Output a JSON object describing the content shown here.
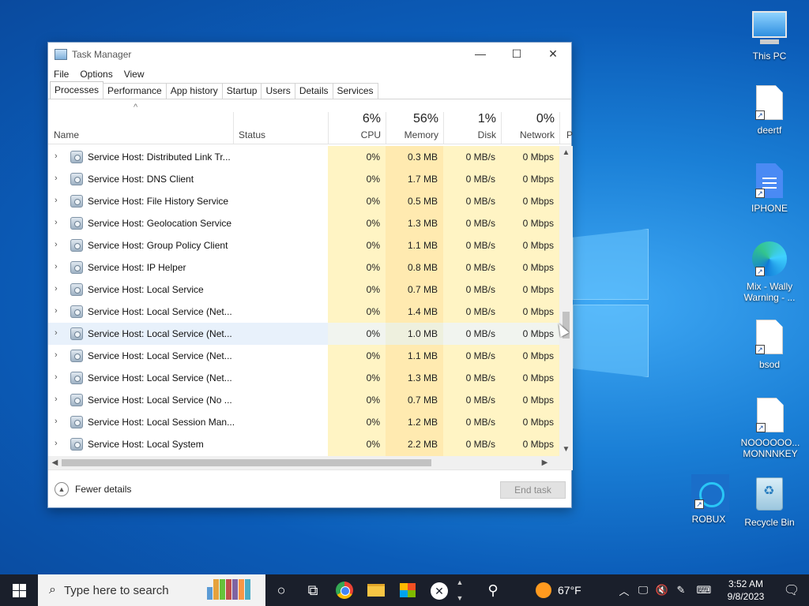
{
  "desktop": {
    "icons": [
      {
        "label": "This PC",
        "icon": "computer-icon"
      },
      {
        "label": "deertf",
        "icon": "text-document-icon"
      },
      {
        "label": "IPHONE",
        "icon": "google-docs-icon"
      },
      {
        "label": "Mix - Wally Warning - ...",
        "icon": "edge-icon"
      },
      {
        "label": "bsod",
        "icon": "text-document-icon"
      },
      {
        "label": "NOOOOOO... MONNNKEY",
        "icon": "text-document-icon"
      },
      {
        "label": "ROBUX",
        "icon": "cortana-icon"
      },
      {
        "label": "Recycle Bin",
        "icon": "recycle-bin-icon"
      }
    ]
  },
  "taskmanager": {
    "title": "Task Manager",
    "controls": {
      "minimize": "—",
      "maximize": "☐",
      "close": "✕"
    },
    "menu": [
      "File",
      "Options",
      "View"
    ],
    "tabs": [
      "Processes",
      "Performance",
      "App history",
      "Startup",
      "Users",
      "Details",
      "Services"
    ],
    "active_tab": "Processes",
    "columns": {
      "name": "Name",
      "status": "Status",
      "cpu": {
        "pct": "6%",
        "label": "CPU"
      },
      "memory": {
        "pct": "56%",
        "label": "Memory"
      },
      "disk": {
        "pct": "1%",
        "label": "Disk"
      },
      "network": {
        "pct": "0%",
        "label": "Network"
      },
      "more": "P"
    },
    "sort_indicator": "^",
    "rows": [
      {
        "name": "Service Host: Distributed Link Tr...",
        "cpu": "0%",
        "memory": "0.3 MB",
        "disk": "0 MB/s",
        "network": "0 Mbps"
      },
      {
        "name": "Service Host: DNS Client",
        "cpu": "0%",
        "memory": "1.7 MB",
        "disk": "0 MB/s",
        "network": "0 Mbps"
      },
      {
        "name": "Service Host: File History Service",
        "cpu": "0%",
        "memory": "0.5 MB",
        "disk": "0 MB/s",
        "network": "0 Mbps"
      },
      {
        "name": "Service Host: Geolocation Service",
        "cpu": "0%",
        "memory": "1.3 MB",
        "disk": "0 MB/s",
        "network": "0 Mbps"
      },
      {
        "name": "Service Host: Group Policy Client",
        "cpu": "0%",
        "memory": "1.1 MB",
        "disk": "0 MB/s",
        "network": "0 Mbps"
      },
      {
        "name": "Service Host: IP Helper",
        "cpu": "0%",
        "memory": "0.8 MB",
        "disk": "0 MB/s",
        "network": "0 Mbps"
      },
      {
        "name": "Service Host: Local Service",
        "cpu": "0%",
        "memory": "0.7 MB",
        "disk": "0 MB/s",
        "network": "0 Mbps"
      },
      {
        "name": "Service Host: Local Service (Net...",
        "cpu": "0%",
        "memory": "1.4 MB",
        "disk": "0 MB/s",
        "network": "0 Mbps"
      },
      {
        "name": "Service Host: Local Service (Net...",
        "cpu": "0%",
        "memory": "1.0 MB",
        "disk": "0 MB/s",
        "network": "0 Mbps",
        "highlighted": true
      },
      {
        "name": "Service Host: Local Service (Net...",
        "cpu": "0%",
        "memory": "1.1 MB",
        "disk": "0 MB/s",
        "network": "0 Mbps"
      },
      {
        "name": "Service Host: Local Service (Net...",
        "cpu": "0%",
        "memory": "1.3 MB",
        "disk": "0 MB/s",
        "network": "0 Mbps"
      },
      {
        "name": "Service Host: Local Service (No ...",
        "cpu": "0%",
        "memory": "0.7 MB",
        "disk": "0 MB/s",
        "network": "0 Mbps"
      },
      {
        "name": "Service Host: Local Session Man...",
        "cpu": "0%",
        "memory": "1.2 MB",
        "disk": "0 MB/s",
        "network": "0 Mbps"
      },
      {
        "name": "Service Host: Local System",
        "cpu": "0%",
        "memory": "2.2 MB",
        "disk": "0 MB/s",
        "network": "0 Mbps"
      }
    ],
    "footer": {
      "fewer_details": "Fewer details",
      "end_task": "End task"
    }
  },
  "taskbar": {
    "search_placeholder": "Type here to search",
    "weather": "67°F",
    "time": "3:52 AM",
    "date": "9/8/2023"
  },
  "colors": {
    "cpu_column": "#fff4c4",
    "memory_column": "#ffeab0",
    "highlight_row": "#e8f1fb",
    "taskbar": "#1a1f2b"
  }
}
